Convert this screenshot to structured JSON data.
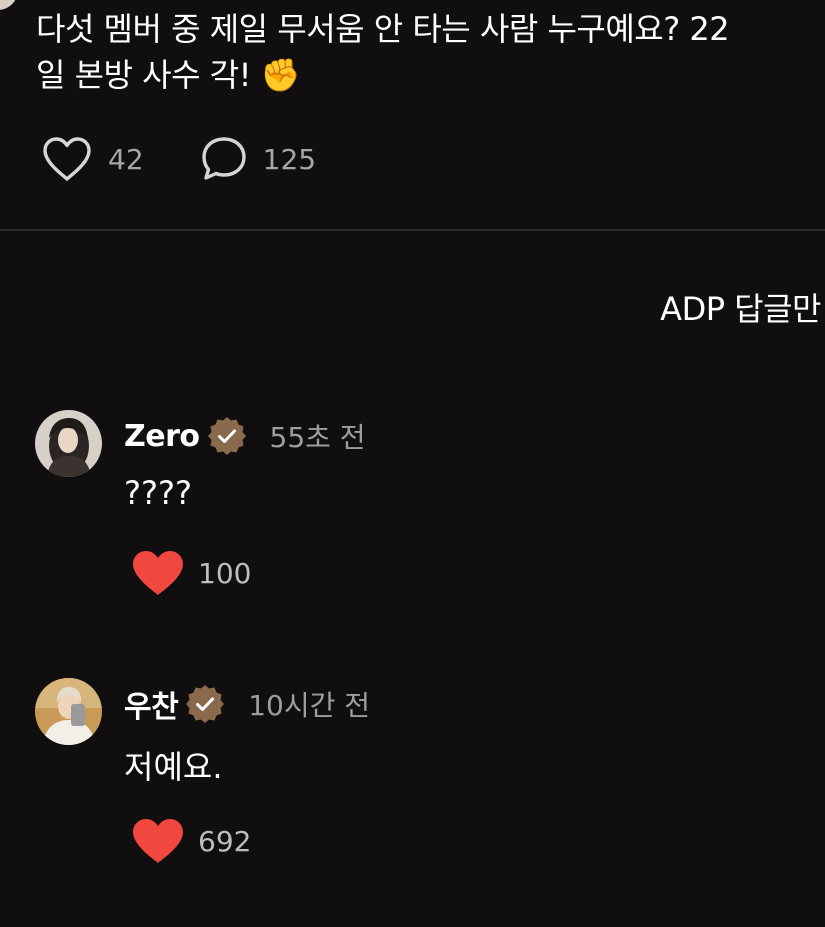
{
  "post": {
    "line1": "다섯 멤버 중 제일 무서움 안 타는 사람 누구예요? 22",
    "line2": "일 본방 사수 각! ✊",
    "likes": "42",
    "comments": "125"
  },
  "filter": {
    "label": "ADP 답글만"
  },
  "replies": [
    {
      "name": "Zero",
      "time": "55초 전",
      "text": "????",
      "likes": "100",
      "badge_icon": "verified-badge-icon"
    },
    {
      "name": "우찬",
      "time": "10시간 전",
      "text": "저예요.",
      "likes": "692",
      "badge_icon": "verified-badge-icon"
    }
  ],
  "colors": {
    "background": "#100e0e",
    "heart_liked": "#f0473f",
    "badge": "#8a6a4c",
    "muted_text": "#a6a6a6"
  }
}
